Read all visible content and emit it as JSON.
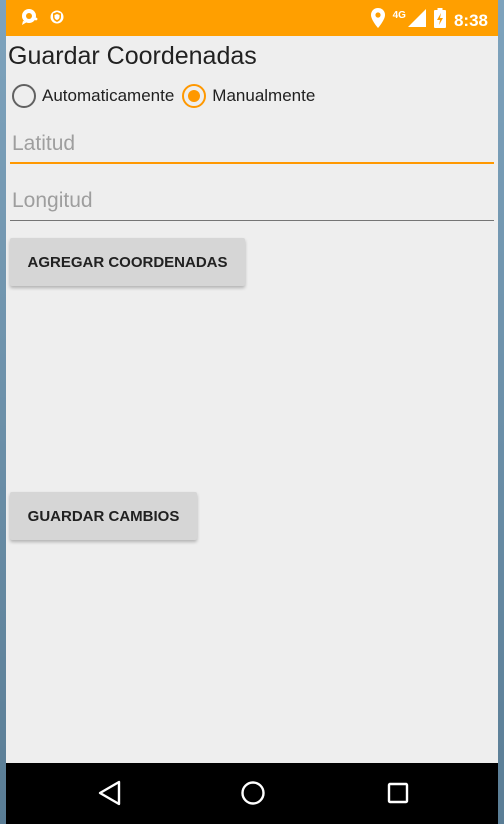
{
  "status_bar": {
    "time": "8:38",
    "network": "4G",
    "bg_color": "#ff9f00",
    "left_icons": [
      "chat-icon",
      "shield-icon"
    ],
    "right_icons": [
      "location-icon",
      "signal-icon",
      "battery-icon"
    ]
  },
  "page": {
    "title": "Guardar Coordenadas"
  },
  "mode": {
    "options": [
      {
        "label": "Automaticamente",
        "checked": false
      },
      {
        "label": "Manualmente",
        "checked": true
      }
    ],
    "accent": "#ff9800"
  },
  "fields": {
    "latitude_placeholder": "Latitud",
    "latitude_value": "",
    "longitude_placeholder": "Longitud",
    "longitude_value": ""
  },
  "buttons": {
    "add_label": "AGREGAR COORDENADAS",
    "save_label": "GUARDAR CAMBIOS"
  },
  "nav_bar": {
    "icons": [
      "back-icon",
      "home-icon",
      "recent-apps-icon"
    ]
  }
}
